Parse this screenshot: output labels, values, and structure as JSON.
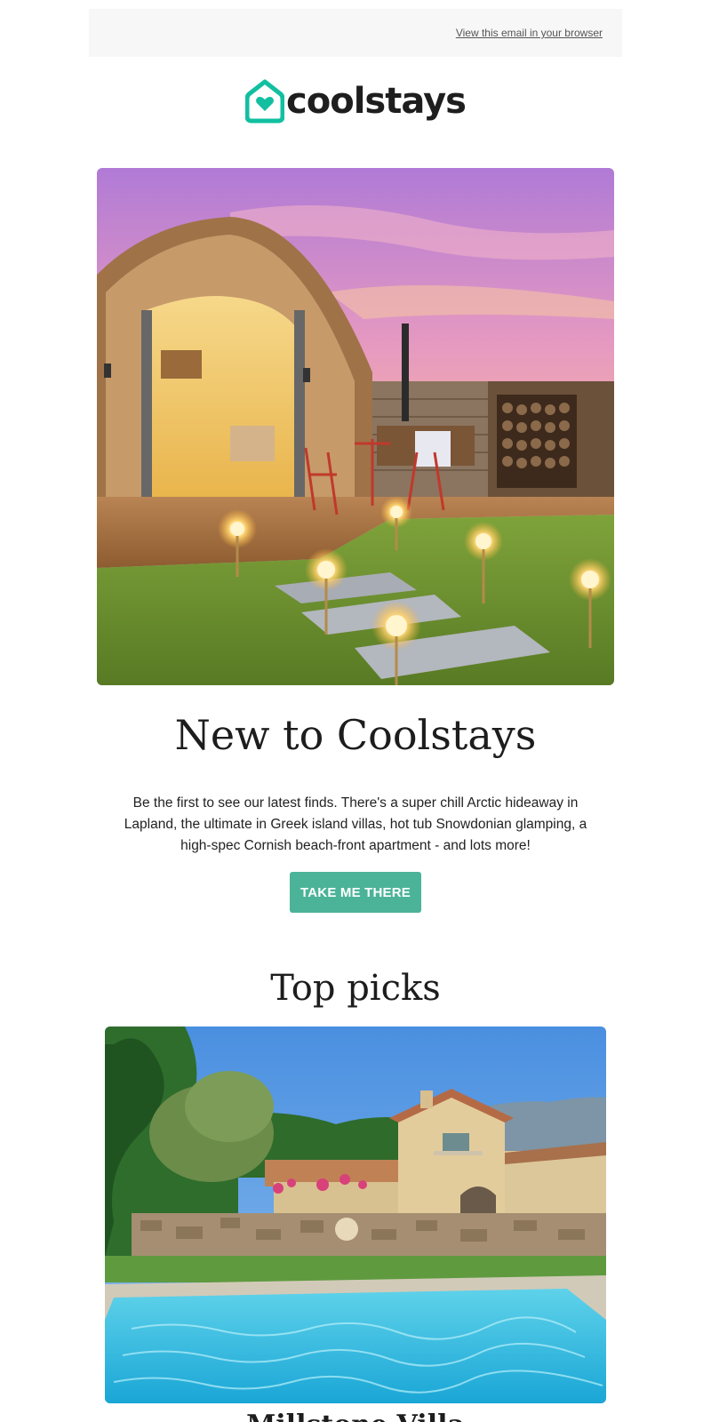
{
  "header": {
    "view_in_browser": "View this email in your browser"
  },
  "brand": {
    "name": "coolstays",
    "accent_color": "#12bfa0",
    "logo_icon": "house-heart-icon"
  },
  "hero": {
    "image_description_icon": "glamping-pod-image",
    "title": "New to Coolstays",
    "body": "Be the first to see our latest finds. There's a super chill Arctic hideaway in Lapland, the ultimate in Greek island villas, hot tub Snowdonian glamping, a high-spec Cornish beach-front apartment - and lots more!",
    "cta_label": "TAKE ME THERE",
    "cta_color": "#4bb398"
  },
  "top_picks": {
    "heading": "Top picks",
    "items": [
      {
        "image_icon": "villa-pool-image",
        "title": "Millstone Villa"
      }
    ]
  }
}
